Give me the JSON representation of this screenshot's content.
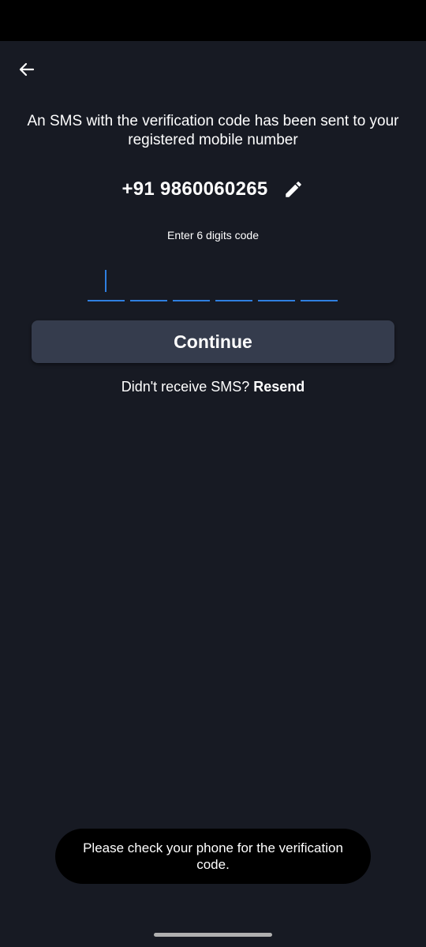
{
  "header": {
    "back_icon": "arrow-left-icon"
  },
  "verification": {
    "message": "An SMS with the verification code has been sent to your registered mobile number",
    "phone_number": "+91 9860060265",
    "edit_icon": "pencil-icon",
    "code_label": "Enter 6 digits code",
    "code_digits": [
      "",
      "",
      "",
      "",
      "",
      ""
    ],
    "continue_label": "Continue",
    "resend_prompt": "Didn't receive SMS?",
    "resend_label": "Resend"
  },
  "toast": {
    "message": "Please check your phone for the verification code."
  },
  "colors": {
    "background": "#171a23",
    "button": "#353c4d",
    "accent": "#2f7fe0",
    "text": "#ffffff"
  }
}
